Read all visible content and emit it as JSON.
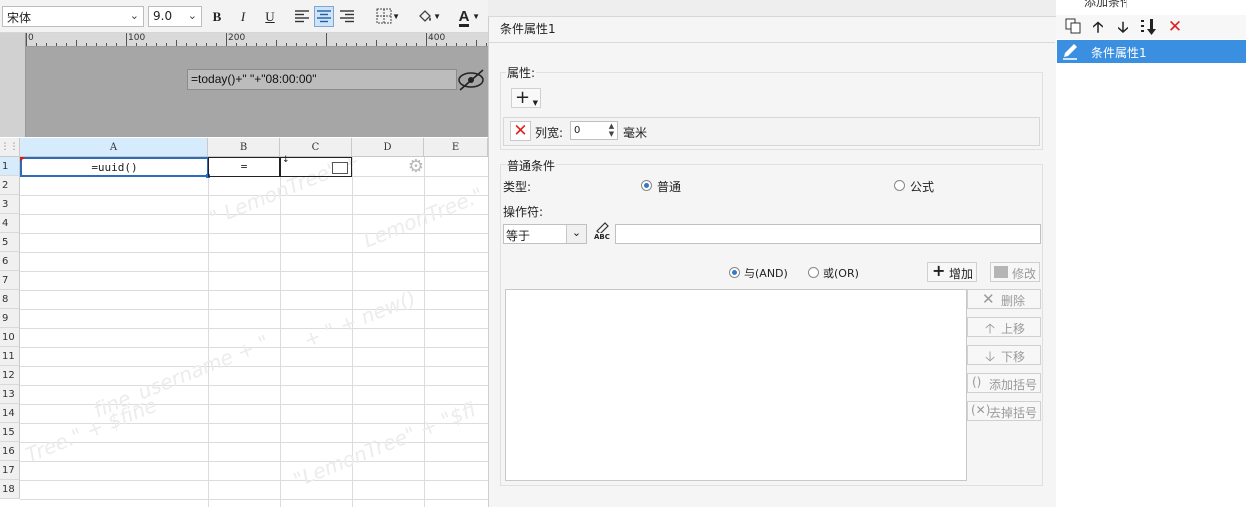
{
  "toolbar": {
    "font_name": "宋体",
    "font_size": "9.0",
    "bold": "B",
    "italic": "I",
    "underline": "U",
    "text_color_letter": "A"
  },
  "sheet": {
    "formula": "=today()+\" \"+\"08:00:00\"",
    "ruler_marks": [
      "0",
      "100",
      "200",
      "400"
    ],
    "columns": [
      "A",
      "B",
      "C",
      "D",
      "E"
    ],
    "rows": [
      "1",
      "2",
      "3",
      "4",
      "5",
      "6",
      "7",
      "8",
      "9",
      "10",
      "11",
      "12",
      "13",
      "14",
      "15",
      "16",
      "17",
      "18"
    ],
    "cell_a1": "=uuid()",
    "cell_b1": "=",
    "watermarks": [
      "\" LemonTree\" +",
      "+ \" + new()",
      "fine_username + \"",
      "Tree.\" + $fine",
      "\"LemonTree\" + \"$fi",
      "LemonTree.\" "
    ]
  },
  "dialog": {
    "title": "条件属性1",
    "properties_label": "属性:",
    "column_width_label": "列宽:",
    "column_width_value": "0",
    "unit": "毫米",
    "normal_condition_label": "普通条件",
    "type_label": "类型:",
    "type_normal": "普通",
    "type_formula": "公式",
    "operator_label": "操作符:",
    "operator_value": "等于",
    "abc_label": "ABC",
    "and_label": "与(AND)",
    "or_label": "或(OR)",
    "add_button": "增加",
    "modify_button": "修改",
    "delete_button": "删除",
    "move_up_button": "上移",
    "move_down_button": "下移",
    "add_bracket_button": "添加括号",
    "remove_bracket_button": "去掉括号"
  },
  "right_panel": {
    "header_label": "添加条件",
    "item_label": "条件属性1"
  },
  "colors": {
    "selection_blue": "#3b8fe0",
    "delete_red": "#e02020",
    "header_blue": "#d6ebfb"
  }
}
